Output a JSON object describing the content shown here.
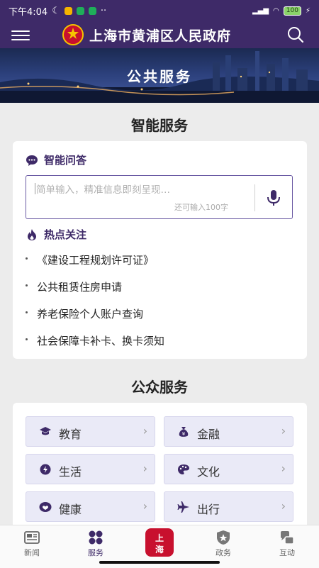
{
  "status": {
    "time": "下午4:04",
    "battery": "100"
  },
  "header": {
    "title": "上海市黄浦区人民政府"
  },
  "banner": {
    "title": "公共服务"
  },
  "smart": {
    "section_title": "智能服务",
    "qa_title": "智能问答",
    "placeholder": "简单输入，精准信息即刻呈现…",
    "counter": "还可输入100字",
    "hot_title": "热点关注",
    "hot_items": [
      "《建设工程规划许可证》",
      "公共租赁住房申请",
      "养老保险个人账户查询",
      "社会保障卡补卡、换卡须知"
    ]
  },
  "public": {
    "section_title": "公众服务",
    "items": [
      {
        "label": "教育",
        "icon": "graduation-cap-icon"
      },
      {
        "label": "金融",
        "icon": "money-bag-icon"
      },
      {
        "label": "生活",
        "icon": "lightning-icon"
      },
      {
        "label": "文化",
        "icon": "palette-icon"
      },
      {
        "label": "健康",
        "icon": "health-icon"
      },
      {
        "label": "出行",
        "icon": "airplane-icon"
      }
    ]
  },
  "tabs": [
    {
      "label": "新闻",
      "icon": "newspaper-icon"
    },
    {
      "label": "服务",
      "icon": "grid-icon"
    },
    {
      "label": "政务",
      "icon": "badge-icon"
    },
    {
      "label": "互动",
      "icon": "interaction-icon"
    }
  ],
  "colors": {
    "primary": "#3e2a68",
    "accent": "#6a5aa3",
    "tile": "#eaeaf7"
  }
}
